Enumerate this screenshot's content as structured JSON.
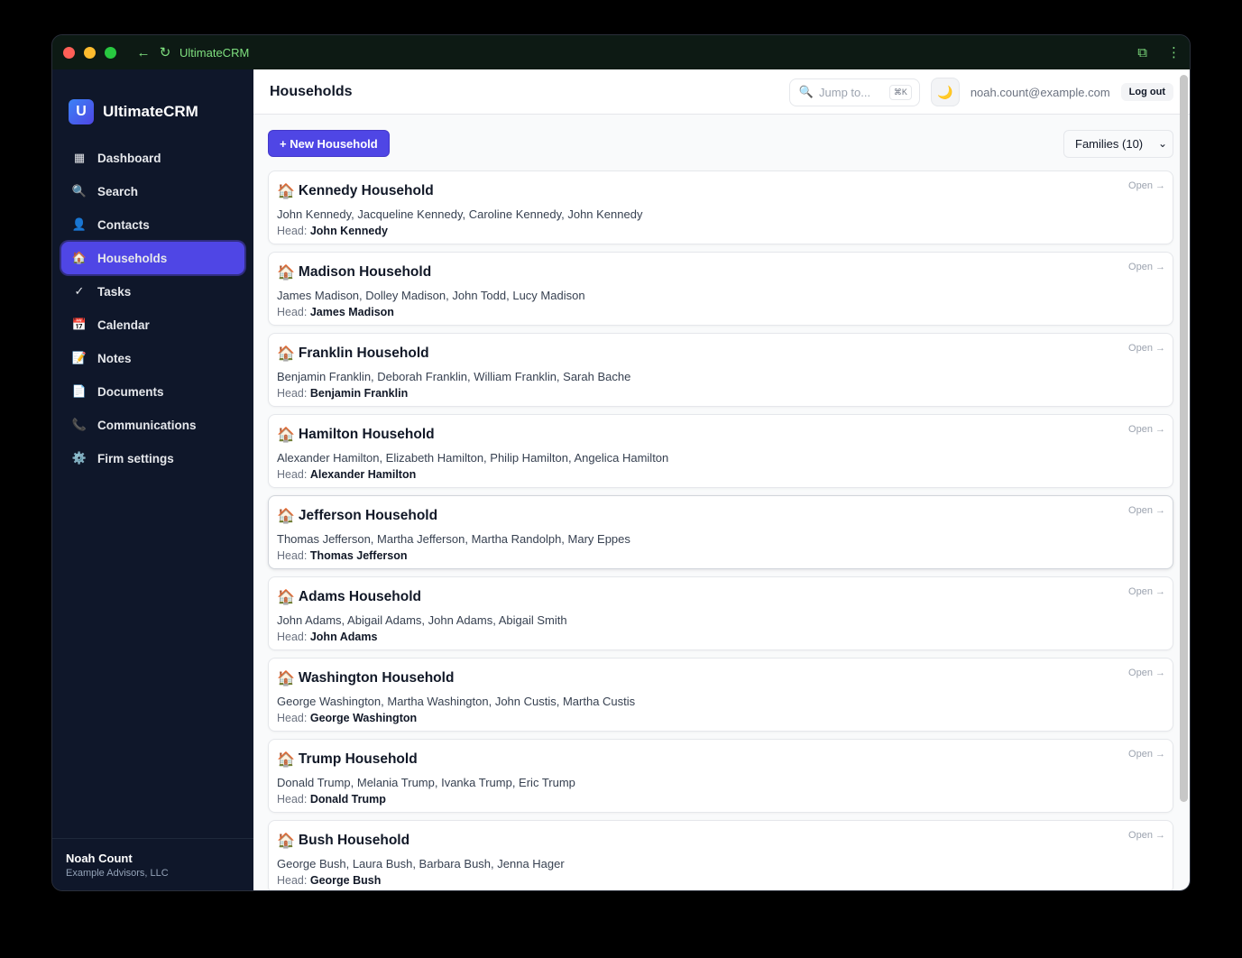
{
  "titlebar": {
    "title": "UltimateCRM"
  },
  "brand": {
    "logo_letter": "U",
    "name": "UltimateCRM"
  },
  "sidebar": {
    "items": [
      {
        "label": "Dashboard",
        "icon": "▦"
      },
      {
        "label": "Search",
        "icon": "🔍"
      },
      {
        "label": "Contacts",
        "icon": "👤"
      },
      {
        "label": "Households",
        "icon": "🏠"
      },
      {
        "label": "Tasks",
        "icon": "✓"
      },
      {
        "label": "Calendar",
        "icon": "📅"
      },
      {
        "label": "Notes",
        "icon": "📝"
      },
      {
        "label": "Documents",
        "icon": "📄"
      },
      {
        "label": "Communications",
        "icon": "📞"
      },
      {
        "label": "Firm settings",
        "icon": "⚙️"
      }
    ],
    "active_index": 3,
    "user": {
      "name": "Noah Count",
      "firm": "Example Advisors, LLC"
    }
  },
  "header": {
    "title": "Households",
    "jump_placeholder": "Jump to...",
    "jump_shortcut": "⌘K",
    "user_email": "noah.count@example.com",
    "logout_label": "Log out"
  },
  "toolbar": {
    "new_label": "+ New Household",
    "filter_value": "Families (10)"
  },
  "households": [
    {
      "name": "Kennedy Household",
      "members": "John Kennedy, Jacqueline Kennedy, Caroline Kennedy, John Kennedy",
      "head": "John Kennedy"
    },
    {
      "name": "Madison Household",
      "members": "James Madison, Dolley Madison, John Todd, Lucy Madison",
      "head": "James Madison"
    },
    {
      "name": "Franklin Household",
      "members": "Benjamin Franklin, Deborah Franklin, William Franklin, Sarah Bache",
      "head": "Benjamin Franklin"
    },
    {
      "name": "Hamilton Household",
      "members": "Alexander Hamilton, Elizabeth Hamilton, Philip Hamilton, Angelica Hamilton",
      "head": "Alexander Hamilton"
    },
    {
      "name": "Jefferson Household",
      "members": "Thomas Jefferson, Martha Jefferson, Martha Randolph, Mary Eppes",
      "head": "Thomas Jefferson"
    },
    {
      "name": "Adams Household",
      "members": "John Adams, Abigail Adams, John Adams, Abigail Smith",
      "head": "John Adams"
    },
    {
      "name": "Washington Household",
      "members": "George Washington, Martha Washington, John Custis, Martha Custis",
      "head": "George Washington"
    },
    {
      "name": "Trump Household",
      "members": "Donald Trump, Melania Trump, Ivanka Trump, Eric Trump",
      "head": "Donald Trump"
    },
    {
      "name": "Bush Household",
      "members": "George Bush, Laura Bush, Barbara Bush, Jenna Hager",
      "head": "George Bush"
    }
  ],
  "card_labels": {
    "head_prefix": "Head:",
    "open_label": "Open →",
    "house_icon": "🏠"
  }
}
